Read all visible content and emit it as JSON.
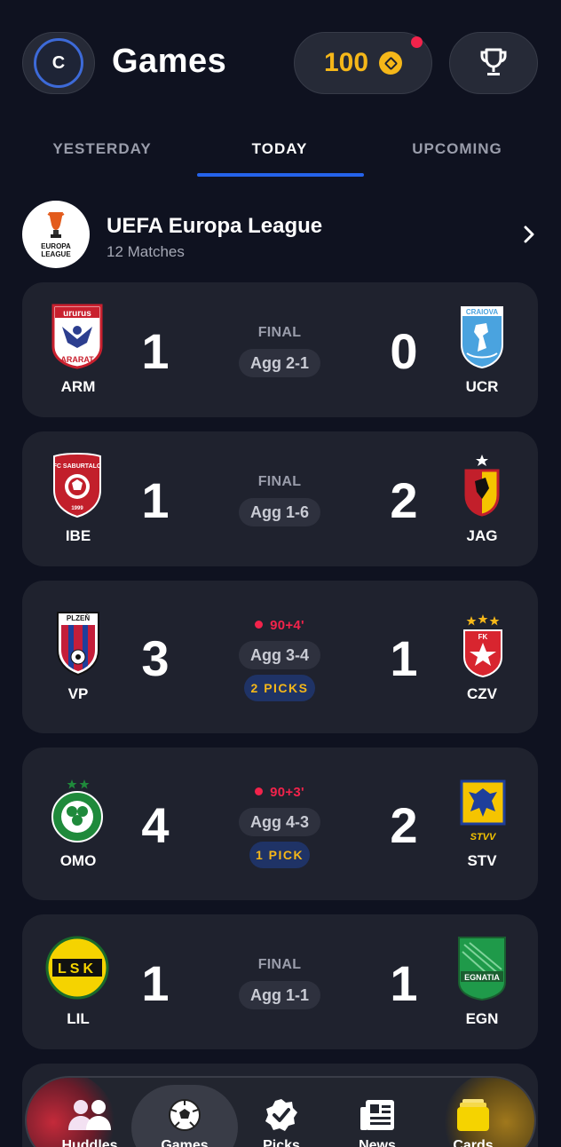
{
  "header": {
    "avatar_initial": "C",
    "title": "Games",
    "coins": "100",
    "icons": {
      "coin": "coin-icon",
      "trophy": "trophy-icon"
    }
  },
  "tabs": [
    {
      "label": "YESTERDAY",
      "active": false
    },
    {
      "label": "TODAY",
      "active": true
    },
    {
      "label": "UPCOMING",
      "active": false
    }
  ],
  "league": {
    "name": "UEFA Europa League",
    "match_count": "12 Matches",
    "logo_text": "EUROPA LEAGUE"
  },
  "matches": [
    {
      "home": "ARM",
      "home_score": "1",
      "away": "UCR",
      "away_score": "0",
      "status": "FINAL",
      "live": false,
      "agg": "Agg 2-1",
      "picks": ""
    },
    {
      "home": "IBE",
      "home_score": "1",
      "away": "JAG",
      "away_score": "2",
      "status": "FINAL",
      "live": false,
      "agg": "Agg 1-6",
      "picks": ""
    },
    {
      "home": "VP",
      "home_score": "3",
      "away": "CZV",
      "away_score": "1",
      "status": "90+4'",
      "live": true,
      "agg": "Agg 3-4",
      "picks": "2 PICKS"
    },
    {
      "home": "OMO",
      "home_score": "4",
      "away": "STV",
      "away_score": "2",
      "status": "90+3'",
      "live": true,
      "agg": "Agg 4-3",
      "picks": "1 PICK"
    },
    {
      "home": "LIL",
      "home_score": "1",
      "away": "EGN",
      "away_score": "1",
      "status": "FINAL",
      "live": false,
      "agg": "Agg 1-1",
      "picks": ""
    }
  ],
  "crest_text": {
    "arm_top": "ururus",
    "arm_bottom": "ARARAT",
    "ucr": "CRAIOVA",
    "ibe": "FC SABURTALO",
    "vp_top": "PLZEŇ",
    "vp_side": "FC VIKTORIA",
    "czv": "FK",
    "stv": "STVV",
    "lil": "LSK",
    "egn": "EGNATIA"
  },
  "bottom_nav": [
    {
      "label": "Huddles",
      "icon": "people-icon",
      "active": false
    },
    {
      "label": "Games",
      "icon": "soccer-ball-icon",
      "active": true
    },
    {
      "label": "Picks",
      "icon": "check-badge-icon",
      "active": false
    },
    {
      "label": "News",
      "icon": "newspaper-icon",
      "active": false
    },
    {
      "label": "Cards",
      "icon": "cards-icon",
      "active": false
    }
  ],
  "colors": {
    "background": "#0f1220",
    "card": "#1f222e",
    "accent_blue": "#2563eb",
    "coin_gold": "#f5b719",
    "live_red": "#f2234b"
  }
}
